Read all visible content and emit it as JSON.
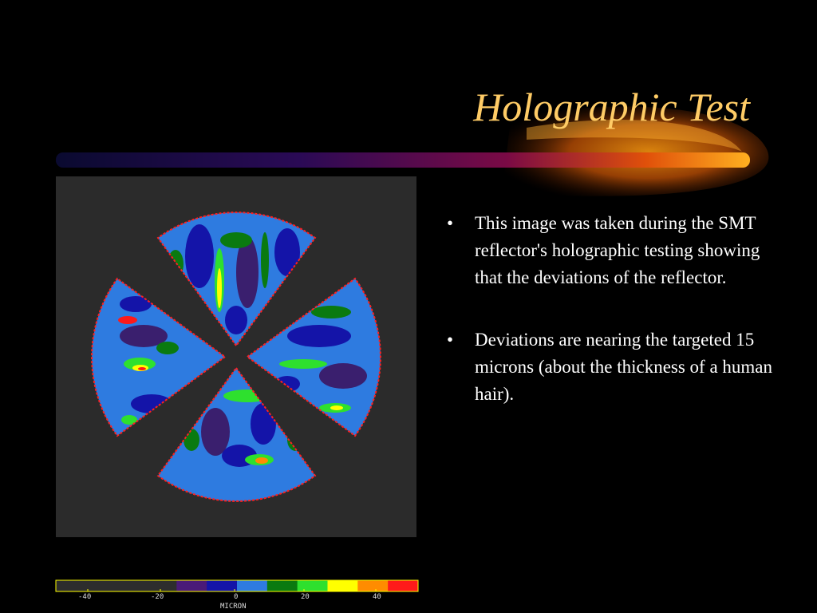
{
  "slide": {
    "title": "Holographic Test",
    "bullets": [
      "This image was taken during the SMT reflector's holographic testing showing that the deviations of the reflector.",
      "Deviations are nearing the targeted 15 microns (about the thickness of a human hair)."
    ],
    "bullet_glyph": "•"
  },
  "colorbar": {
    "ticks": [
      "-40",
      "-20",
      "0",
      "20",
      "40"
    ],
    "unit": "MICRON",
    "colors": [
      "#2d2d2d",
      "#2d2d2d",
      "#2d2d2d",
      "#2d2d2d",
      "#4a1a78",
      "#1414a8",
      "#2e7be0",
      "#0a7a10",
      "#2ee02e",
      "#ffff00",
      "#ff8c00",
      "#ff1a1a"
    ]
  },
  "theme": {
    "background": "#000000",
    "title_color": "#ffcc66",
    "text_color": "#ffffff",
    "map_colors": {
      "deep_low": "#3a1f6e",
      "low": "#1414a8",
      "mid": "#2e7be0",
      "high": "#0a7a10",
      "higher": "#2ee02e",
      "peak_yellow": "#ffff00",
      "peak_orange": "#ff8c00",
      "peak_red": "#ff1a1a"
    }
  }
}
